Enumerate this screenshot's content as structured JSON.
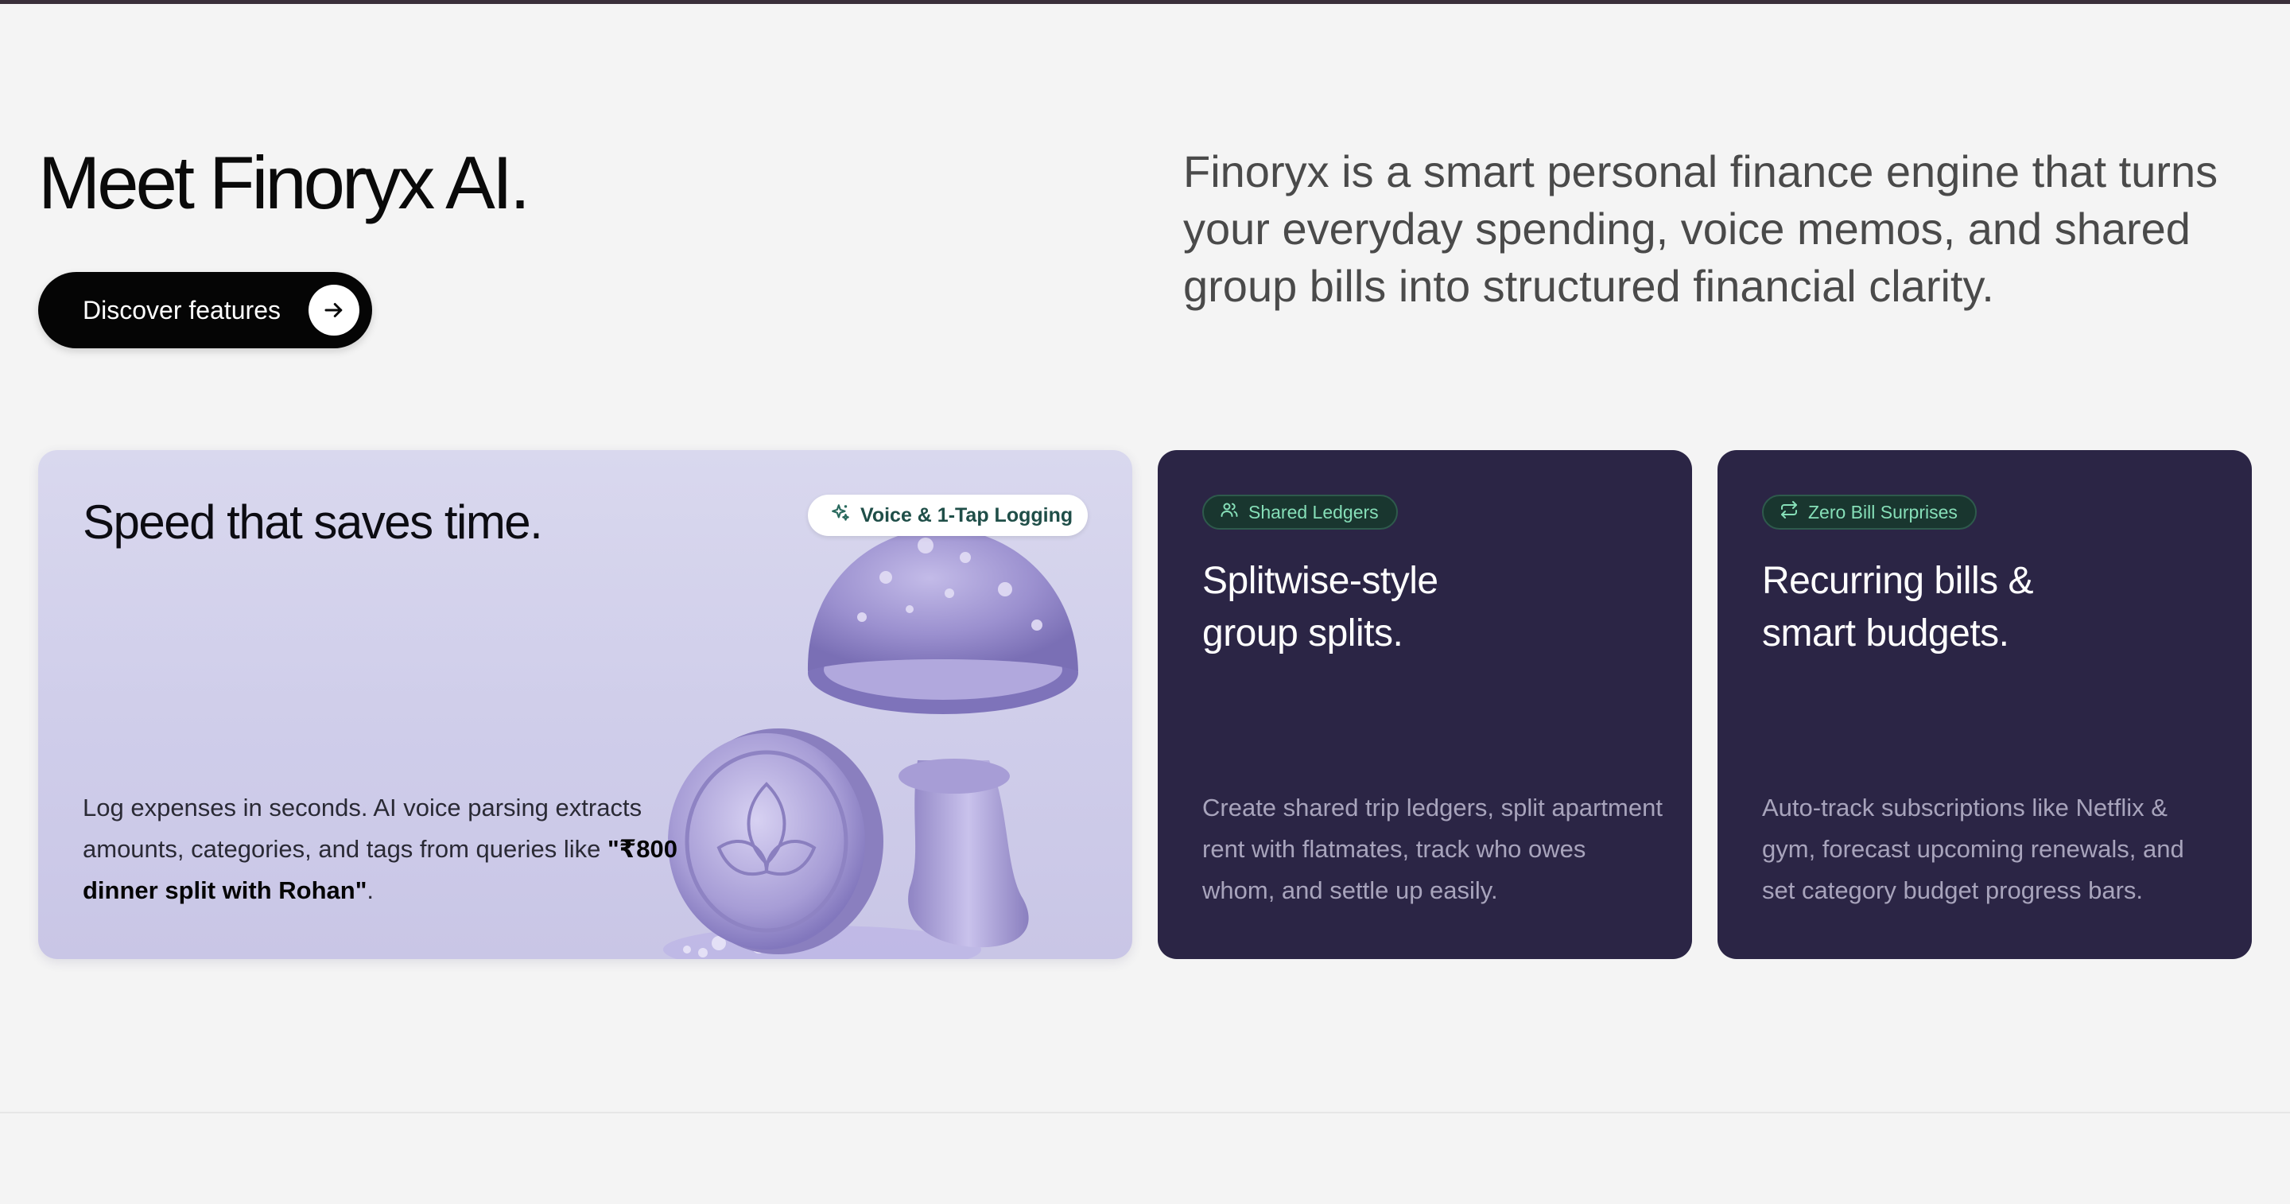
{
  "hero": {
    "title": "Meet Finoryx AI.",
    "cta_label": "Discover features",
    "description": "Finoryx is a smart personal finance engine that turns your everyday spending, voice memos, and shared group bills into structured financial clarity."
  },
  "cards": {
    "speed": {
      "title": "Speed that saves time.",
      "badge": "Voice & 1-Tap Logging",
      "description": "Log expenses in seconds. AI voice parsing extracts amounts, categories, and tags from queries like ",
      "quote": "\"₹800 dinner split with Rohan\"",
      "period": "."
    },
    "split": {
      "badge": "Shared Ledgers",
      "title_line1": "Splitwise-style",
      "title_line2": "group splits.",
      "description": "Create shared trip ledgers, split apartment rent with flatmates, track who owes whom, and settle up easily."
    },
    "bills": {
      "badge": "Zero Bill Surprises",
      "title_line1": "Recurring bills &",
      "title_line2": "smart budgets.",
      "description": "Auto-track subscriptions like Netflix & gym, forecast upcoming renewals, and set category budget progress bars."
    }
  },
  "colors": {
    "page_bg": "#f4f4f4",
    "dark_card": "#2b2545",
    "badge_green": "#86dfb8",
    "speed_card": "#d2d0ec"
  },
  "icons": {
    "cta": "arrow-right-icon",
    "speed_badge": "sparkles-icon",
    "split_badge": "users-icon",
    "bills_badge": "repeat-icon"
  }
}
